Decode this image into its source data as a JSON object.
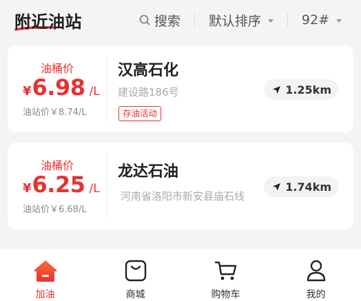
{
  "header": {
    "title": "附近油站",
    "search_label": "搜索",
    "sort_label": "默认排序",
    "fuel_label": "92#"
  },
  "stations": [
    {
      "price_label": "油桶价",
      "currency": "¥",
      "price": "6.98",
      "unit": "/L",
      "station_price": "油站价￥8.74/L",
      "name": "汉高石化",
      "address": "建设路186号",
      "promo": "存油活动",
      "distance": "1.25km"
    },
    {
      "price_label": "油桶价",
      "currency": "¥",
      "price": "6.25",
      "unit": "/L",
      "station_price": "油站价￥6.68/L",
      "name": "龙达石油",
      "address": "河南省洛阳市新安县庙石线",
      "distance": "1.74km"
    }
  ],
  "nav": [
    {
      "label": "加油",
      "icon": "home-icon",
      "active": true
    },
    {
      "label": "商城",
      "icon": "shop-icon",
      "active": false
    },
    {
      "label": "购物车",
      "icon": "cart-icon",
      "active": false
    },
    {
      "label": "我的",
      "icon": "user-icon",
      "active": false
    }
  ],
  "colors": {
    "accent": "#e8322f",
    "background": "#f4f4f4"
  }
}
